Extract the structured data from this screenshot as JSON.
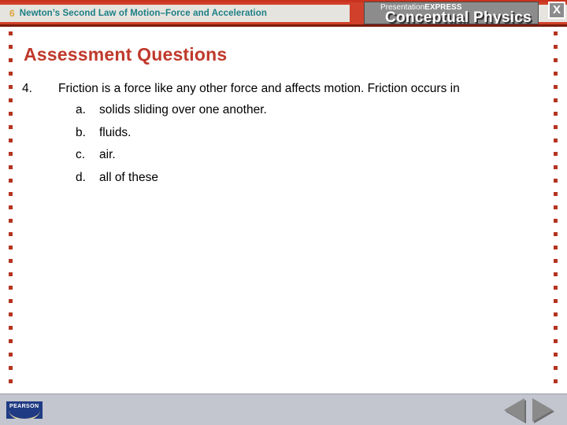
{
  "header": {
    "chapter_number": "6",
    "chapter_title": "Newton’s Second Law of Motion–Force and Acceleration",
    "brand_prefix": "Presentation",
    "brand_suffix": "EXPRESS",
    "product_title": "Conceptual Physics",
    "close_label": "X"
  },
  "slide": {
    "title": "Assessment Questions",
    "question": {
      "number": "4.",
      "text": "Friction is a force like any other force and affects motion. Friction occurs in",
      "choices": [
        {
          "letter": "a.",
          "text": "solids sliding over one another."
        },
        {
          "letter": "b.",
          "text": "fluids."
        },
        {
          "letter": "c.",
          "text": "air."
        },
        {
          "letter": "d.",
          "text": "all of these"
        }
      ]
    }
  },
  "footer": {
    "publisher": "PEARSON",
    "prev_label": "Previous slide",
    "next_label": "Next slide"
  },
  "colors": {
    "header_red": "#d1402a",
    "chapter_number": "#d9a441",
    "chapter_title": "#1b7f86",
    "slide_title": "#c0392b",
    "dot_red": "#b5341f",
    "brand_gray": "#8c8c8c",
    "footer_gray": "#c3c5cf",
    "pearson_blue": "#1f3b83"
  }
}
